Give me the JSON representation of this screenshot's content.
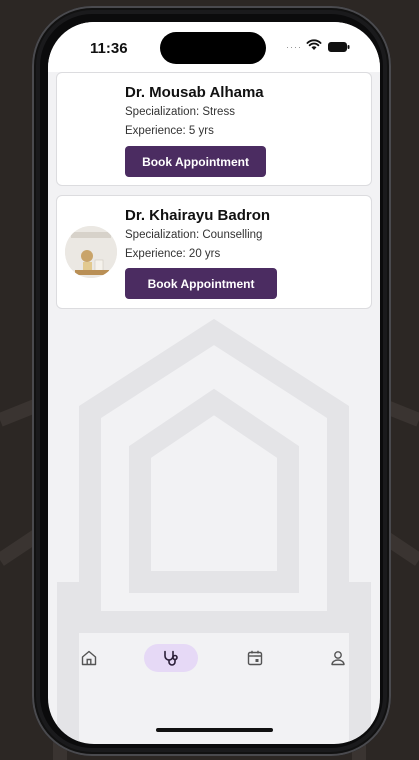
{
  "status_bar": {
    "time": "11:36"
  },
  "doctors": [
    {
      "name": "Dr. Mousab Alhama",
      "specialization": "Specialization: Stress",
      "experience": "Experience: 5 yrs",
      "button_label": "Book Appointment"
    },
    {
      "name": "Dr. Khairayu  Badron",
      "specialization": "Specialization: Counselling",
      "experience": "Experience: 20 yrs",
      "button_label": "Book Appointment"
    }
  ],
  "tab_bar": {
    "items": [
      {
        "icon": "home-icon",
        "active": false
      },
      {
        "icon": "stethoscope-icon",
        "active": true
      },
      {
        "icon": "calendar-icon",
        "active": false
      },
      {
        "icon": "profile-icon",
        "active": false
      }
    ]
  },
  "colors": {
    "accent": "#4b2c61",
    "active_tab": "#e6d9f6",
    "backdrop": "#2c2724"
  }
}
